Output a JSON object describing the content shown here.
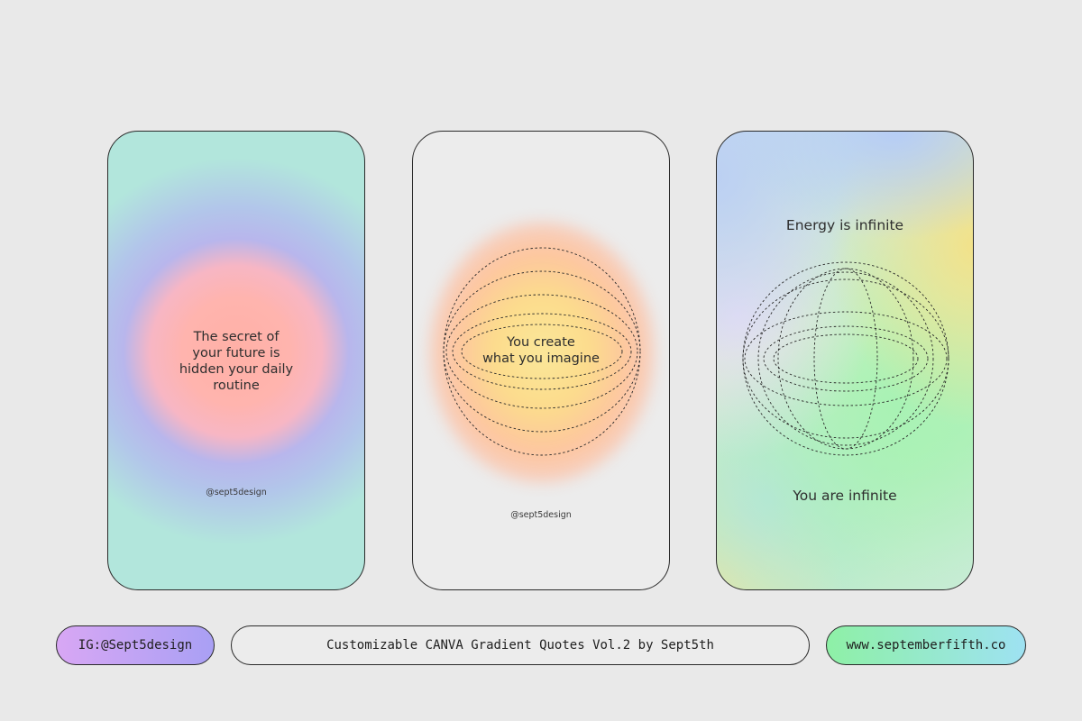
{
  "cards": [
    {
      "quote": "The secret of\nyour future is\nhidden your daily\nroutine",
      "handle": "@sept5design"
    },
    {
      "quote": "You create\nwhat you imagine",
      "handle": "@sept5design"
    },
    {
      "quote_top": "Energy is infinite",
      "quote_bottom": "You are infinite"
    }
  ],
  "footer": {
    "instagram": "IG:@Sept5design",
    "title": "Customizable CANVA Gradient Quotes Vol.2 by Sept5th",
    "website": "www.septemberfifth.co"
  },
  "colors": {
    "background": "#e9e9e9",
    "card1_mint": "#b2e6dc",
    "card1_peach": "#ffb0a6",
    "card1_lavender": "#b8b6ec",
    "card2_yellow": "#fbe79a",
    "card3_green": "#a8f2b4",
    "card3_blue": "#b6cdf6",
    "ig_pill_start": "#d8a7f4",
    "ig_pill_end": "#a9a0f4",
    "web_pill_start": "#8ef0a6",
    "web_pill_end": "#9ee2f2"
  }
}
